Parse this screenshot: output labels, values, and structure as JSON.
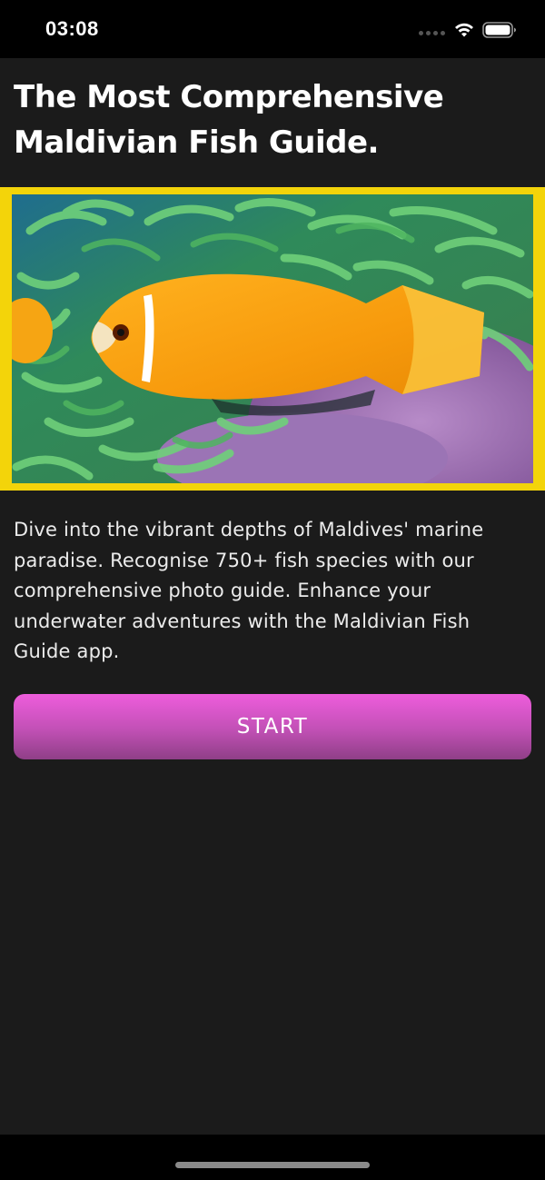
{
  "status_bar": {
    "time": "03:08",
    "icons": [
      "signal-dots-icon",
      "wifi-icon",
      "battery-icon"
    ]
  },
  "page": {
    "title": "The Most Comprehensive Maldivian Fish Guide.",
    "hero_image": "clownfish-in-anemone",
    "description": "Dive into the vibrant depths of Maldives' marine paradise. Recognise 750+ fish species with our comprehensive photo guide. Enhance your underwater adventures with the Maldivian Fish Guide app.",
    "start_label": "START"
  },
  "colors": {
    "background": "#1b1b1b",
    "frame": "#f3d40a",
    "button_top": "#ee5ddc",
    "button_bottom": "#8f3f87"
  }
}
